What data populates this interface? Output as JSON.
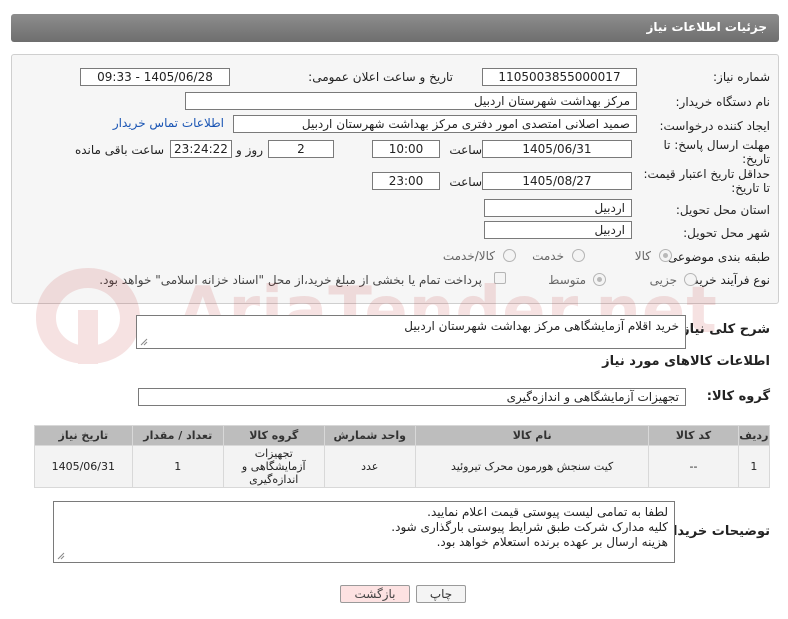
{
  "header": {
    "title": "جزئیات اطلاعات نیاز"
  },
  "form": {
    "need_number": {
      "label": "شماره نیاز:",
      "value": "1105003855000017"
    },
    "announce_datetime": {
      "label": "تاریخ و ساعت اعلان عمومی:",
      "value": "1405/06/28 - 09:33"
    },
    "buyer_org": {
      "label": "نام دستگاه خریدار:",
      "value": "مرکز بهداشت شهرستان اردبیل"
    },
    "requester": {
      "label": "ایجاد کننده درخواست:",
      "value": "صمید اصلانی امتصدی امور دفتری  مرکز بهداشت شهرستان اردبیل",
      "contact_link": "اطلاعات تماس خریدار"
    },
    "reply_deadline": {
      "label_line1": "مهلت ارسال پاسخ: تا",
      "label_line2": "تاریخ:",
      "date": "1405/06/31",
      "time_label": "ساعت",
      "time": "10:00",
      "days": "2",
      "days_label": "روز و",
      "remaining": "23:24:22",
      "remaining_label": "ساعت باقی مانده"
    },
    "price_validity": {
      "label_line1": "حداقل تاریخ اعتبار قیمت:",
      "label_line2": "تا تاریخ:",
      "date": "1405/08/27",
      "time_label": "ساعت",
      "time": "23:00"
    },
    "delivery_province": {
      "label": "استان محل تحویل:",
      "value": "اردبیل"
    },
    "delivery_city": {
      "label": "شهر محل تحویل:",
      "value": "اردبیل"
    },
    "category": {
      "label": "طبقه بندی موضوعی:",
      "options": [
        "کالا",
        "خدمت",
        "کالا/خدمت"
      ],
      "selected": "کالا"
    },
    "purchase_type": {
      "label": "نوع فرآیند خرید :",
      "options": [
        "جزیی",
        "متوسط"
      ],
      "selected": "متوسط",
      "payment_note": "پرداخت تمام یا بخشی از مبلغ خرید،از محل \"اسناد خزانه اسلامی\" خواهد بود."
    }
  },
  "description": {
    "label": "شرح کلی نیاز:",
    "value": "خرید اقلام آزمایشگاهی مرکز بهداشت شهرستان اردبیل"
  },
  "goods_section": {
    "title": "اطلاعات کالاهای مورد نیاز",
    "group_label": "گروه کالا:",
    "group_value": "تجهیزات آزمایشگاهی و اندازه‌گیری"
  },
  "table": {
    "headers": [
      "ردیف",
      "کد کالا",
      "نام کالا",
      "واحد شمارش",
      "گروه کالا",
      "تعداد / مقدار",
      "تاریخ نیاز"
    ],
    "rows": [
      {
        "row": "1",
        "code": "--",
        "name": "کیت سنجش هورمون محرک تیروئید",
        "unit": "عدد",
        "group": "تجهیزات آزمایشگاهی و اندازه‌گیری",
        "qty": "1",
        "date": "1405/06/31"
      }
    ]
  },
  "buyer_notes": {
    "label": "توضیحات خریدار:",
    "lines": [
      "لطفا به تمامی لیست پیوستی قیمت اعلام نمایید.",
      "کلیه مدارک شرکت طبق شرایط پیوستی بارگذاری شود.",
      "هزینه ارسال بر عهده برنده استعلام خواهد بود."
    ]
  },
  "buttons": {
    "print": "چاپ",
    "back": "بازگشت"
  },
  "watermark": {
    "text": "AriaTender.net"
  },
  "colors": {
    "header": "#7a7a7a",
    "link": "#1a55b4",
    "back_button": "#fde2e2",
    "watermark": "#b71c1c"
  }
}
